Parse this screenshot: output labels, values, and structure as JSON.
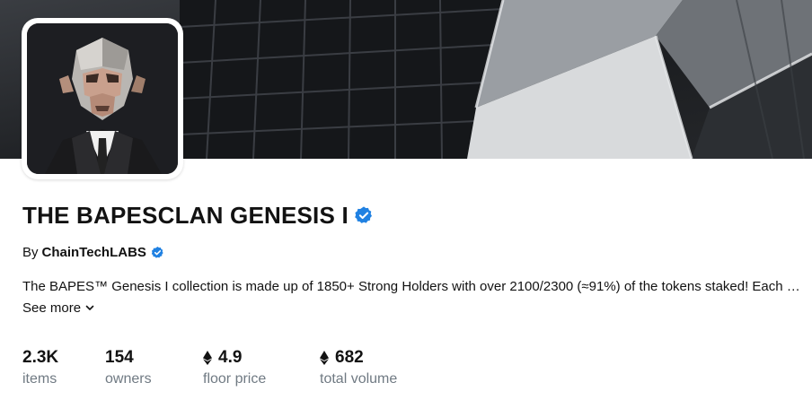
{
  "collection": {
    "title": "THE BAPESCLAN GENESIS I",
    "by_prefix": "By",
    "creator": "ChainTechLABS",
    "description": "The BAPES™ Genesis I collection is made up of 1850+ Strong Holders with over 2100/2300 (≈91%) of the tokens staked! Each NFT is a key to a private circle",
    "see_more": "See more"
  },
  "stats": [
    {
      "value": "2.3K",
      "label": "items",
      "currency_icon": ""
    },
    {
      "value": "154",
      "label": "owners",
      "currency_icon": ""
    },
    {
      "value": "4.9",
      "label": "floor price",
      "currency_icon": "ethereum-icon"
    },
    {
      "value": "682",
      "label": "total volume",
      "currency_icon": "ethereum-icon"
    }
  ],
  "colors": {
    "verified": "#2081e2",
    "muted_text": "#707a83",
    "banner_dark": "#2a2d31"
  }
}
